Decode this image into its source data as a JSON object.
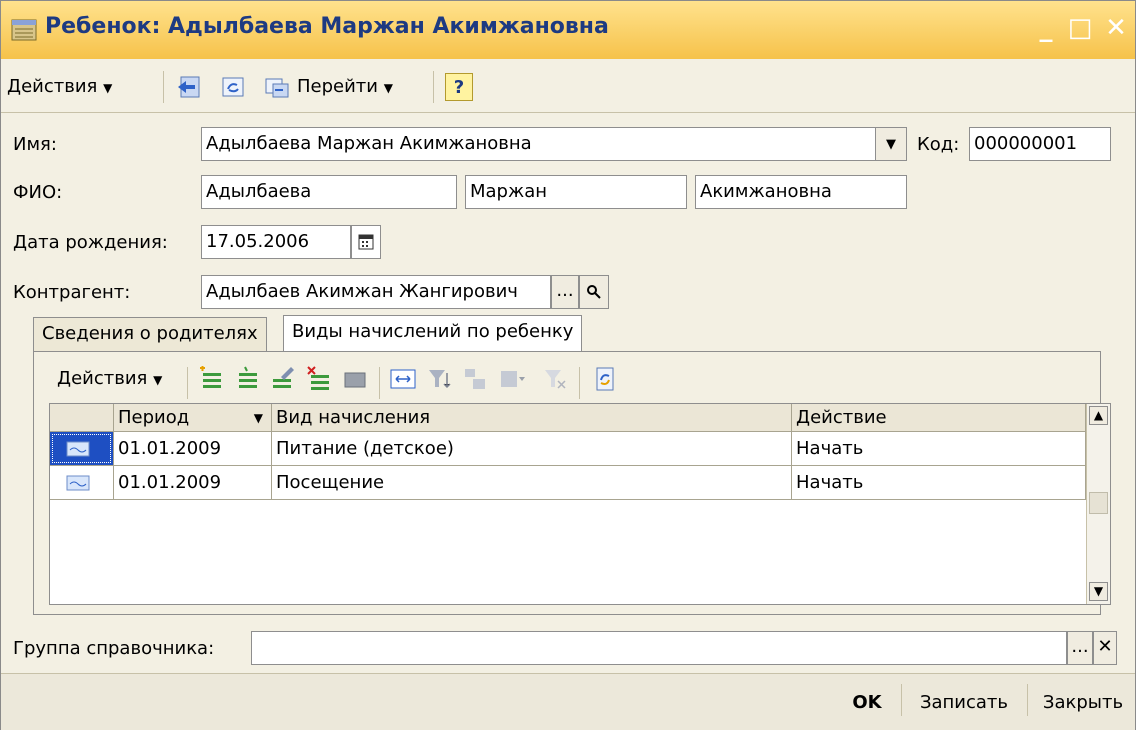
{
  "window": {
    "title": "Ребенок: Адылбаева Маржан Акимжановна",
    "minimize_label": "_",
    "maximize_label": "□",
    "close_label": "✕"
  },
  "toolbar": {
    "actions_label": "Действия",
    "goto_label": "Перейти",
    "help_label": "?"
  },
  "form": {
    "name_label": "Имя:",
    "name_value": "Адылбаева Маржан Акимжановна",
    "code_label": "Код:",
    "code_value": "000000001",
    "fio_label": "ФИО:",
    "last_name": "Адылбаева",
    "first_name": "Маржан",
    "patronymic": "Акимжановна",
    "birth_label": "Дата рождения:",
    "birth_value": "17.05.2006",
    "contractor_label": "Контрагент:",
    "contractor_value": "Адылбаев Акимжан Жангирович",
    "ellipsis": "...",
    "group_label": "Группа справочника:",
    "group_value": ""
  },
  "tabs": [
    {
      "label": "Сведения о родителях",
      "active": false
    },
    {
      "label": "Виды начислений по ребенку",
      "active": true
    }
  ],
  "grid_toolbar": {
    "actions_label": "Действия"
  },
  "grid": {
    "columns": [
      "Период",
      "Вид начисления",
      "Действие"
    ],
    "rows": [
      {
        "period": "01.01.2009",
        "kind": "Питание (детское)",
        "action": "Начать",
        "selected": true
      },
      {
        "period": "01.01.2009",
        "kind": "Посещение",
        "action": "Начать",
        "selected": false
      }
    ]
  },
  "bottom": {
    "ok_label": "OK",
    "save_label": "Записать",
    "close_label": "Закрыть"
  },
  "colors": {
    "title_bg": "#f6c24a",
    "title_text": "#1d3a82",
    "form_bg": "#f3f0e3",
    "selection": "#1e4fc2"
  }
}
